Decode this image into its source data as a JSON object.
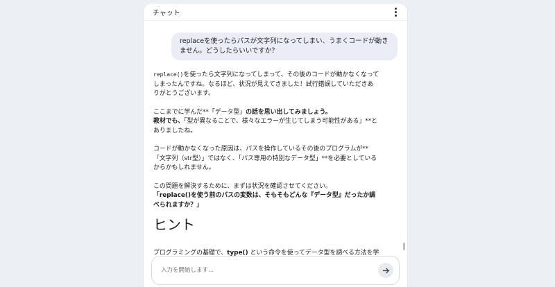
{
  "header": {
    "title": "チャット",
    "more_icon": "more-vert-icon"
  },
  "user_message": "replaceを使ったらパスが文字列になってしまい、うまくコードが動きません。どうしたらいいですか？",
  "assistant": {
    "p1_code": "replace()",
    "p1_text": "を使ったら文字列になってしまって、その後のコードが動かなくなってしまったんですね。なるほど、状況が見えてきました！試行錯誤していただきありがとうございます。",
    "p2_normal": "ここまでに学んだ**「データ型」",
    "p2_bold1": "の話を思い出してみましょう。",
    "p2_bold2": "教材でも、",
    "p2_rest": "「型が異なることで、様々なエラーが生じてしまう可能性がある」**とありましたね。",
    "p3": "コードが動かなくなった原因は、パスを操作しているその後のプログラムが**「文字列（str型）」ではなく、「パス専用の特別なデータ型」**を必要としているからかもしれません。",
    "p4_line1": "この問題を解決するために、まずは状況を確認させてください。",
    "p4_bold": "「replace()を使う前のパスの変数は、そもそもどんな『データ型』だったか調べられますか？」",
    "heading": "ヒント",
    "p5_a": "プログラミングの基礎で、",
    "p5_code": "type()",
    "p5_b": " という命令を使ってデータ型を調べる方法を学びましたね。（例えば print(type(\"お肉\")) のように使います）"
  },
  "input": {
    "placeholder": "入力を開始します...",
    "value": "",
    "send_icon": "arrow-right-icon"
  }
}
